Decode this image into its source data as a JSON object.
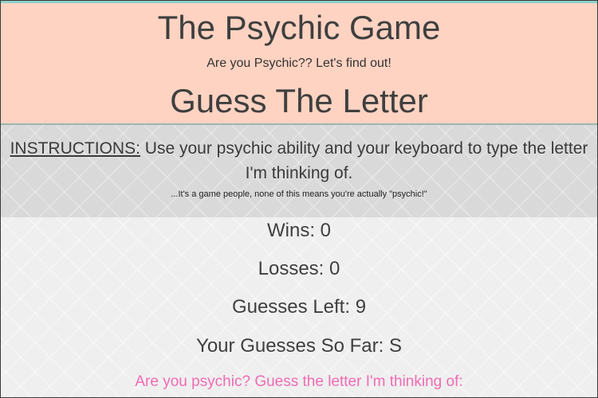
{
  "header": {
    "title": "The Psychic Game",
    "tagline": "Are you Psychic?? Let's find out!",
    "subtitle": "Guess The Letter"
  },
  "instructions": {
    "label": "INSTRUCTIONS:",
    "text": "Use your psychic ability and your keyboard to type the letter I'm thinking of.",
    "disclaimer": "...It's a game people, none of this means you're actually \"psychic!\""
  },
  "stats": {
    "wins_label": "Wins:",
    "wins": "0",
    "losses_label": "Losses:",
    "losses": "0",
    "guesses_left_label": "Guesses Left:",
    "guesses_left": "9",
    "guesses_so_far_label": "Your Guesses So Far:",
    "guesses_so_far": "S"
  },
  "prompt": "Are you psychic? Guess the letter I'm thinking of:",
  "colors": {
    "header_bg": "#ffd3c2",
    "prompt": "#f06bb3",
    "text": "#3f3f3f"
  }
}
